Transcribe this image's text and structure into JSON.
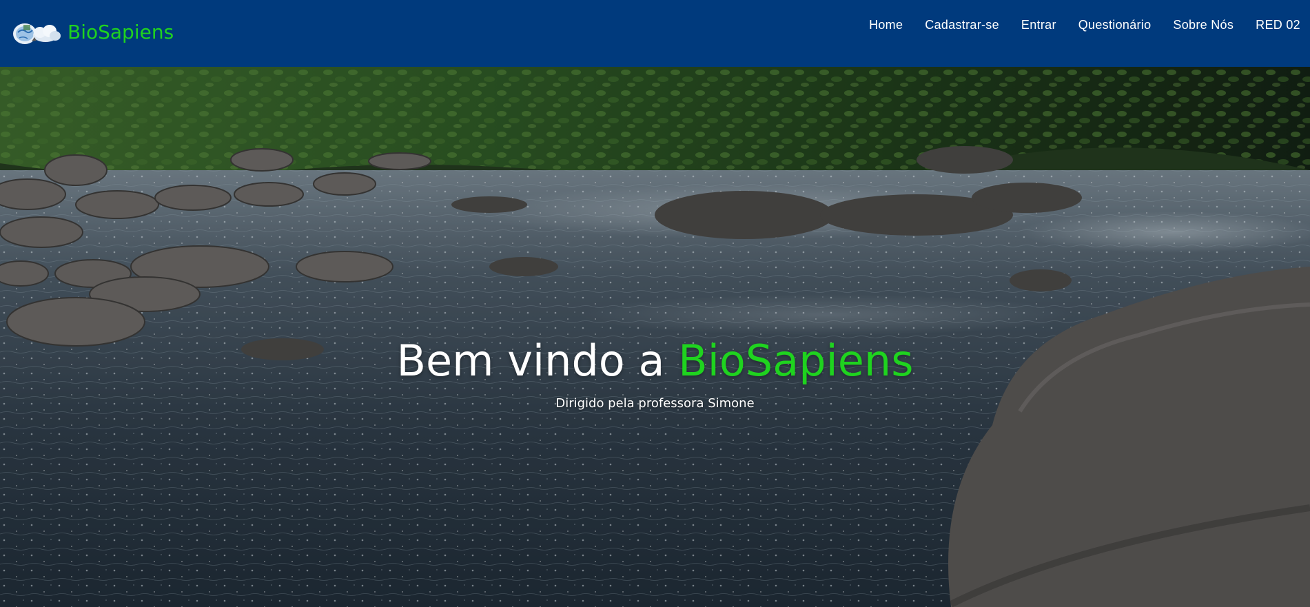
{
  "brand": {
    "name": "BioSapiens",
    "logo_icon": "globe-cloud-logo-icon"
  },
  "nav": {
    "items": [
      {
        "label": "Home"
      },
      {
        "label": "Cadastrar-se"
      },
      {
        "label": "Entrar"
      },
      {
        "label": "Questionário"
      },
      {
        "label": "Sobre Nós"
      },
      {
        "label": "RED 02"
      }
    ]
  },
  "hero": {
    "title_prefix": "Bem vindo a ",
    "title_accent": "BioSapiens",
    "subtitle": "Dirigido pela professora Simone",
    "background": "river-rocks-forest-photo"
  },
  "colors": {
    "navbar_bg": "#003a7d",
    "accent_green": "#1fd31f",
    "nav_text": "#ffffff"
  }
}
